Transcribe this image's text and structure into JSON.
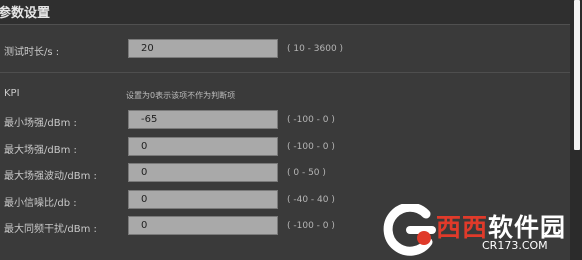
{
  "header": {
    "title": "参数设置"
  },
  "test_duration": {
    "label": "测试时长/s :",
    "value": "20",
    "range": "( 10 - 3600 )"
  },
  "kpi": {
    "section_label": "KPI",
    "hint": "设置为0表示该项不作为判断项",
    "fields": [
      {
        "label": "最小场强/dBm :",
        "value": "-65",
        "range": "( -100 - 0 )"
      },
      {
        "label": "最大场强/dBm :",
        "value": "0",
        "range": "( -100 - 0 )"
      },
      {
        "label": "最大场强波动/dBm :",
        "value": "0",
        "range": "( 0 - 50 )"
      },
      {
        "label": "最小信噪比/db :",
        "value": "0",
        "range": "( -40 - 40 )"
      },
      {
        "label": "最大同频干扰/dBm :",
        "value": "0",
        "range": "( -100 - 0 )"
      }
    ]
  },
  "watermark": {
    "brand_red": "西西",
    "brand_white": "软件园",
    "url": "CR173.COM"
  }
}
